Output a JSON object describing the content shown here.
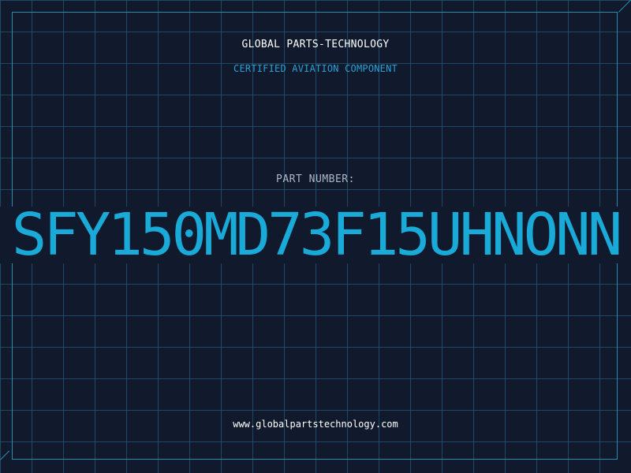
{
  "header": {
    "company": "GLOBAL PARTS-TECHNOLOGY",
    "subtitle": "CERTIFIED AVIATION COMPONENT"
  },
  "part": {
    "label": "PART NUMBER:",
    "number": "SFY150MD73F15UHNONN"
  },
  "footer": {
    "website": "www.globalpartstechnology.com"
  },
  "colors": {
    "background": "#111a2c",
    "grid": "#286e87",
    "accent": "#1aaad8",
    "text": "#ffffff"
  }
}
